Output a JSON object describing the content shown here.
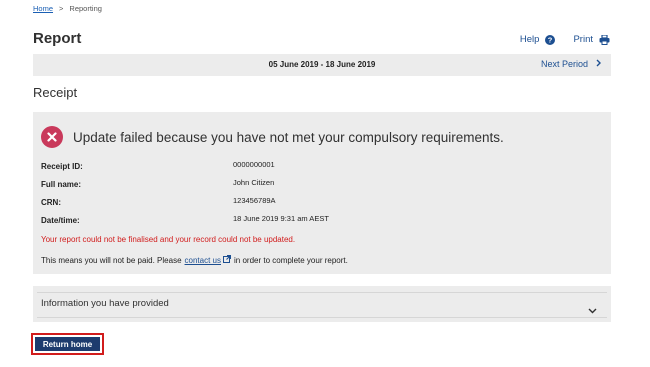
{
  "breadcrumb": {
    "home": "Home",
    "separator": ">",
    "current": "Reporting"
  },
  "header": {
    "title": "Report",
    "help_label": "Help",
    "help_icon": "question-circle-icon",
    "print_label": "Print",
    "print_icon": "printer-icon"
  },
  "period": {
    "range": "05 June 2019 - 18 June 2019",
    "next_label": "Next Period",
    "next_icon": "chevron-right-icon"
  },
  "receipt": {
    "heading": "Receipt",
    "error_icon": "error-x-circle-icon",
    "error_color": "#c9395b",
    "error_message": "Update failed because you have not met your compulsory requirements.",
    "details": [
      {
        "label": "Receipt ID:",
        "value": "0000000001"
      },
      {
        "label": "Full name:",
        "value": "John Citizen"
      },
      {
        "label": "CRN:",
        "value": "123456789A"
      },
      {
        "label": "Date/time:",
        "value": "18 June 2019 9:31 am AEST"
      }
    ],
    "failure_note": "Your report could not be finalised and your record could not be updated.",
    "failure_color": "#d11c1c",
    "pay_note_before": "This means you will not be paid. Please",
    "contact_link": "contact us",
    "pay_note_after": "in order to complete your report."
  },
  "accordion": {
    "title": "Information you have provided",
    "icon": "chevron-down-icon"
  },
  "actions": {
    "return_home": "Return home"
  },
  "colors": {
    "link": "#1d4f91",
    "panel": "#ececec",
    "button": "#1d3b6e",
    "focus_border": "#d11c1c"
  }
}
